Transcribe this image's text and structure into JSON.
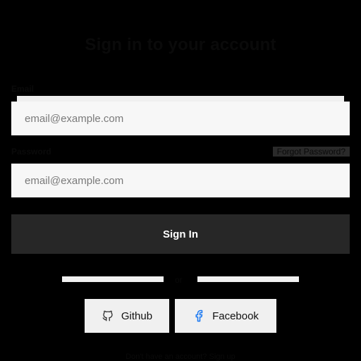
{
  "form": {
    "title": "Sign in to your account",
    "email_label": "Email",
    "email_placeholder": "email@example.com",
    "password_label": "Password",
    "password_placeholder": "email@example.com",
    "forgot_link": "Forgot Password?",
    "signin_label": "Sign In",
    "divider_text": "or"
  },
  "social": {
    "github_label": "Github",
    "github_icon": "github-icon",
    "facebook_label": "Facebook",
    "facebook_icon": "facebook-icon",
    "facebook_color": "#1877F2"
  },
  "footer": {
    "text": "Don't have an account? Sign up"
  },
  "colors": {
    "background": "#000000",
    "input_background": "#F7F7F7",
    "primary_button": "#272727"
  }
}
